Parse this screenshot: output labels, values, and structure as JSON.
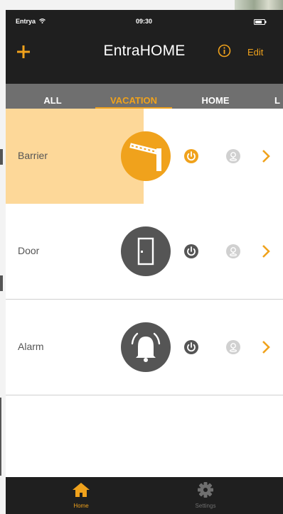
{
  "status": {
    "carrier": "Entrya",
    "time": "09:30"
  },
  "header": {
    "title": "EntraHOME",
    "edit_label": "Edit"
  },
  "tabs": [
    {
      "label": "ALL",
      "active": false
    },
    {
      "label": "VACATION",
      "active": true
    },
    {
      "label": "HOME",
      "active": false
    },
    {
      "label": "L",
      "active": false
    }
  ],
  "devices": [
    {
      "name": "Barrier",
      "icon": "barrier-icon",
      "active": true
    },
    {
      "name": "Door",
      "icon": "door-icon",
      "active": false
    },
    {
      "name": "Alarm",
      "icon": "alarm-bell-icon",
      "active": false
    }
  ],
  "bottom_tabs": [
    {
      "label": "Home",
      "icon": "home-icon",
      "active": true
    },
    {
      "label": "Settings",
      "icon": "gear-icon",
      "active": false
    }
  ],
  "colors": {
    "accent": "#f0a21c",
    "bar_background": "#1f1f1f",
    "tab_background": "#6f6f6f",
    "highlight": "#fdd899",
    "inactive_icon": "#555555"
  }
}
